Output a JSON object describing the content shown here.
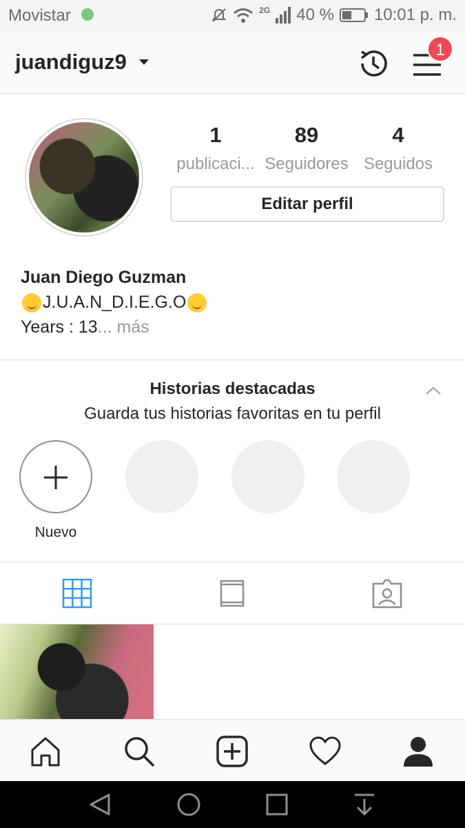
{
  "status_bar": {
    "carrier": "Movistar",
    "network": "2G",
    "battery": "40 %",
    "time": "10:01 p. m."
  },
  "top_nav": {
    "username": "juandiguz9",
    "notification_count": "1"
  },
  "profile": {
    "stats": [
      {
        "value": "1",
        "label": "publicaci..."
      },
      {
        "value": "89",
        "label": "Seguidores"
      },
      {
        "value": "4",
        "label": "Seguidos"
      }
    ],
    "edit_button": "Editar perfil",
    "full_name": "Juan Diego Guzman",
    "bio_line1": "J.U.A.N_D.I.E.G.O",
    "bio_line2": "Years :  13",
    "bio_more": "... más"
  },
  "highlights": {
    "title": "Historias destacadas",
    "subtitle": "Guarda tus historias favoritas en tu perfil",
    "new_label": "Nuevo"
  },
  "tabs": [
    "grid-icon",
    "feed-icon",
    "tagged-icon"
  ],
  "colors": {
    "accent_blue": "#3897f0",
    "badge_red": "#ed4956",
    "text": "#262626",
    "muted": "#999999"
  }
}
